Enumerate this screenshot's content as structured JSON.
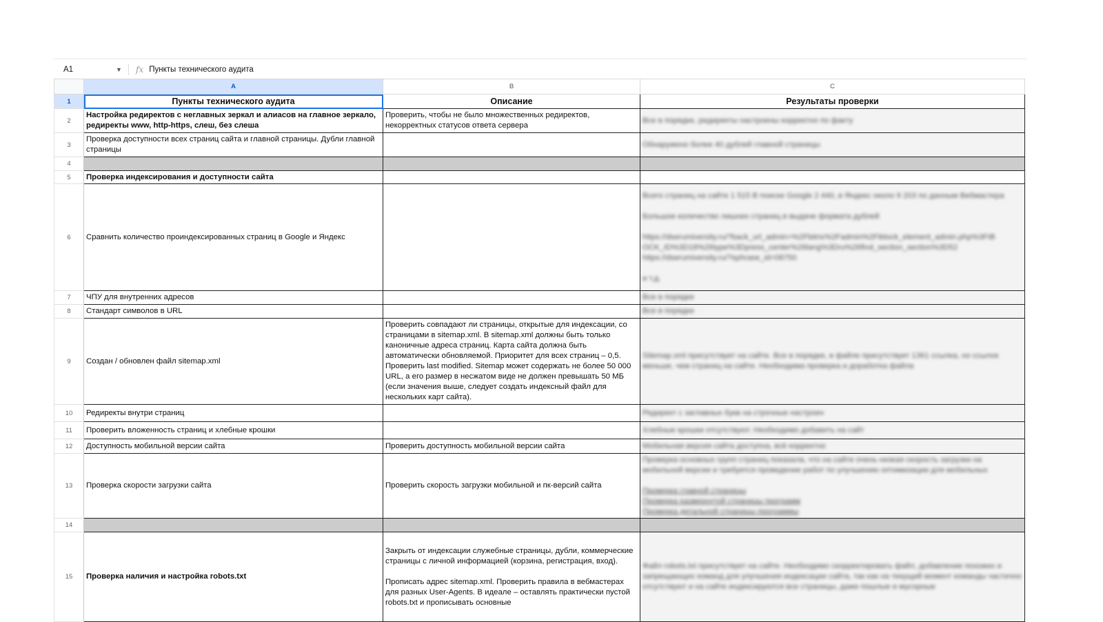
{
  "formula_bar": {
    "cell_ref": "A1",
    "fx": "fx",
    "content": "Пункты технического аудита"
  },
  "columns": [
    "A",
    "B",
    "C"
  ],
  "header": {
    "a": "Пункты технического аудита",
    "b": "Описание",
    "c": "Результаты проверки"
  },
  "rows": [
    {
      "n": "2",
      "a": "Настройка редиректов с неглавных зеркал и алиасов на главное зеркало, редиректы www, http-https, слеш, без слеша",
      "b": "Проверить, чтобы не было множественных редиректов, некорректных статусов ответа сервера",
      "c": "Все в порядке, редиректы настроены корректно по факту"
    },
    {
      "n": "3",
      "a": "Проверка доступности всех страниц сайта и главной страницы. Дубли главной страницы",
      "b": "",
      "c": "Обнаружено более 40 дублей главной страницы"
    },
    {
      "n": "4"
    },
    {
      "n": "5",
      "a": "Проверка индексирования и доступности сайта"
    },
    {
      "n": "6",
      "a": "Сравнить количество проиндексированных страниц в Google и Яндекс",
      "b": "",
      "c": "Всего страниц на сайте 1 515 В поиске Google 2 440, в Яндекс около 9 203 по данным Вебмастера\n\nБольшое количество лишних страниц в выдаче формата дублей\n\nhttps://dserumiversity.ru/?back_url_admin=%2Fbitrix%2Fadmin%2Fiblock_element_admin.php%3FIB\nOCK_ID%3D18%26type%3Dpress_center%26lang%3Dru%26find_section_section%3D52\nhttps://dserumiversity.ru/?sphrase_id=08750\n\nи т.д."
    },
    {
      "n": "7",
      "a": "ЧПУ для внутренних адресов",
      "b": "",
      "c": "Все в порядке"
    },
    {
      "n": "8",
      "a": "Стандарт символов в URL",
      "b": "",
      "c": "Все в порядке"
    },
    {
      "n": "9",
      "a": "Создан / обновлен файл sitemap.xml",
      "b": "Проверить совпадают ли страницы, открытые для индексации, со страницами в sitemap.xml. В sitemap.xml должны быть только каноничные адреса страниц. Карта сайта должна быть автоматически обновляемой. Приоритет для всех страниц – 0,5. Проверить last modified. Sitemap может содержать не более 50 000 URL, а его размер в несжатом виде не должен превышать 50 МБ (если значения выше, следует создать индексный файл для нескольких карт сайта).",
      "c": "Sitemap.xml присутствует на сайте. Все в порядке, в файле присутствует 1361 ссылка, но ссылок меньше, чем страниц на сайте. Необходима проверка и доработка файла"
    },
    {
      "n": "10",
      "a": "Редиректы внутри страниц",
      "b": "",
      "c": "Редирект с заглавных букв на строчные настроен"
    },
    {
      "n": "11",
      "a": "Проверить вложенность страниц и хлебные крошки",
      "b": "",
      "c": "Хлебные крошки отсутствуют. Необходимо добавить на сайт"
    },
    {
      "n": "12",
      "a": "Доступность мобильной версии сайта",
      "b": "Проверить доступность мобильной версии сайта",
      "c": "Мобильная версия сайта доступна, всё корректно"
    },
    {
      "n": "13",
      "a": "Проверка скорости загрузки сайта",
      "b": "Проверить скорость загрузки мобильной и пк-версий сайта",
      "c": "Проверка основных групп страниц показала, что на сайте очень низкая скорость загрузки на мобильной версии и требуется проведение работ по улучшению оптимизации для мобильных",
      "c_links": [
        "Проверка главной страницы",
        "Проверка развернутой страницы программ",
        "Проверка детальной страницы программы"
      ]
    },
    {
      "n": "14"
    },
    {
      "n": "15",
      "a": "Проверка наличия и настройка robots.txt",
      "b": "Закрыть от индексации служебные страницы, дубли, коммерческие страницы с личной информацией (корзина, регистрация, вход).\n\nПрописать адрес sitemap.xml. Проверить правила в вебмастерах для разных User-Agents. В идеале – оставлять практически пустой robots.txt и прописывать основные",
      "c": "Файл robots.txt присутствует на сайте. Необходимо скорректировать файл, добавление похожих и запрещающих команд для улучшения индексации сайта, так как на текущий момент команды частично отсутствуют и на сайте индексируются все страницы, даже пошлые и мусорные"
    }
  ]
}
